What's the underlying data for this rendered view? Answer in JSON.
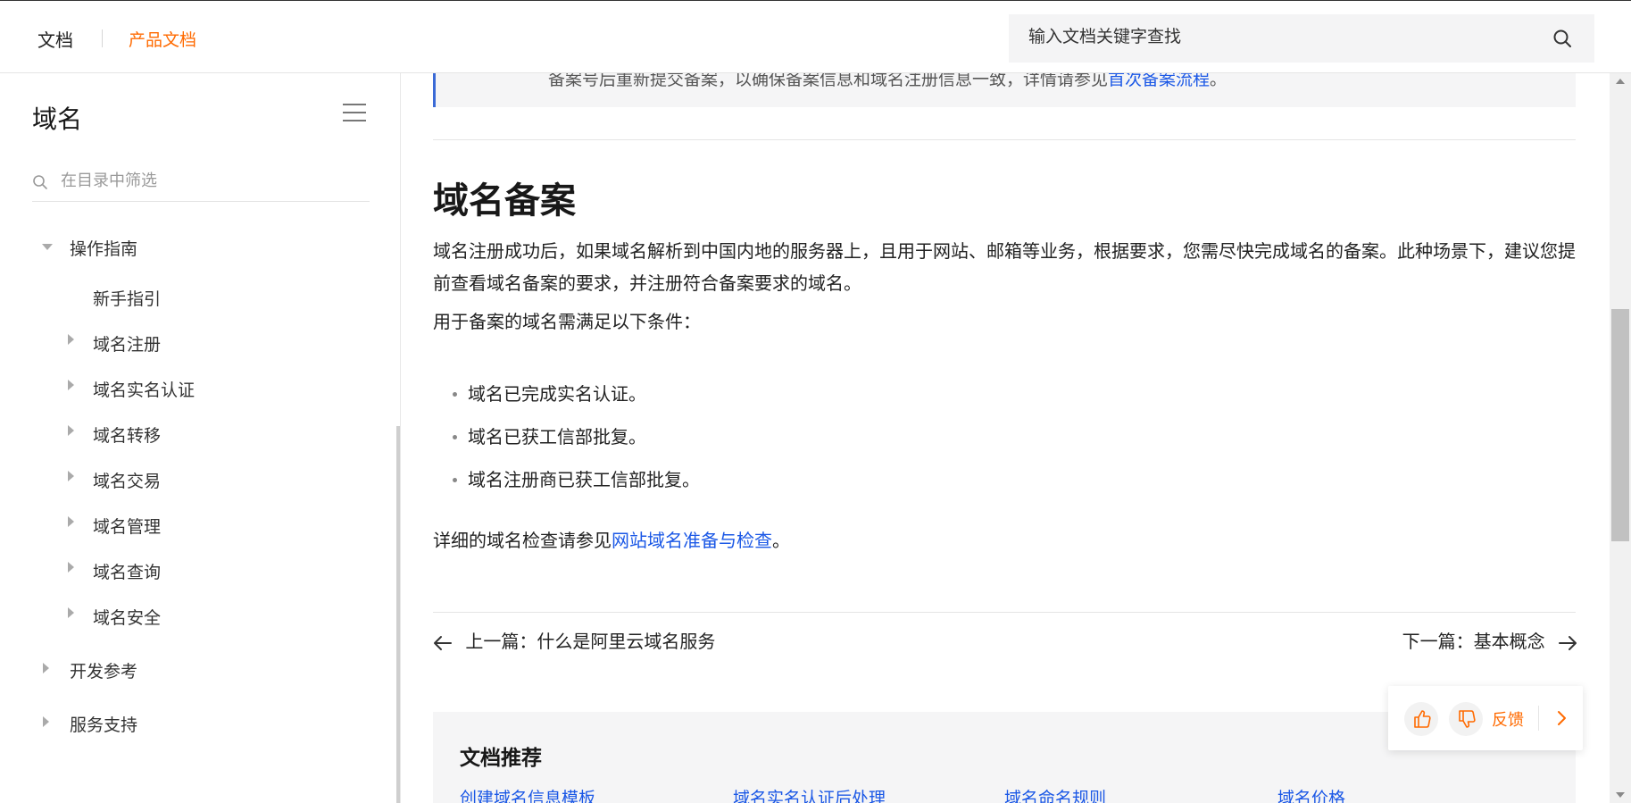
{
  "header": {
    "brand": "文档",
    "brand_sub": "产品文档",
    "search_placeholder": "输入文档关键字查找",
    "accent_color": "#ff6a00"
  },
  "sidebar": {
    "title": "域名",
    "filter_placeholder": "在目录中筛选",
    "items": [
      {
        "label": "操作指南",
        "state": "expanded"
      },
      {
        "label": "新手指引"
      },
      {
        "label": "域名注册",
        "state": "collapsed"
      },
      {
        "label": "域名实名认证",
        "state": "collapsed"
      },
      {
        "label": "域名转移",
        "state": "collapsed"
      },
      {
        "label": "域名交易",
        "state": "collapsed"
      },
      {
        "label": "域名管理",
        "state": "collapsed"
      },
      {
        "label": "域名查询",
        "state": "collapsed"
      },
      {
        "label": "域名安全",
        "state": "collapsed"
      },
      {
        "label": "开发参考",
        "state": "collapsed"
      },
      {
        "label": "服务支持",
        "state": "collapsed"
      }
    ]
  },
  "content": {
    "note_text": "备案号后重新提交备案，以确保备案信息和域名注册信息一致，详情请参见",
    "note_link": "首次备案流程",
    "note_tail": "。",
    "heading": "域名备案",
    "para1": "域名注册成功后，如果域名解析到中国内地的服务器上，且用于网站、邮箱等业务，根据要求，您需尽快完成域名的备案。此种场景下，建议您提前查看域名备案的要求，并注册符合备案要求的域名。",
    "para2": "用于备案的域名需满足以下条件：",
    "bullets": [
      "域名已完成实名认证。",
      "域名已获工信部批复。",
      "域名注册商已获工信部批复。"
    ],
    "para3_prefix": "详细的域名检查请参见",
    "para3_link": "网站域名准备与检查",
    "para3_suffix": "。",
    "prev": "上一篇：什么是阿里云域名服务",
    "next": "下一篇：基本概念",
    "recommend_title": "文档推荐",
    "recommend_links": [
      "创建域名信息模板",
      "域名实名认证后处理",
      "域名命名规则",
      "域名价格"
    ]
  },
  "feedback": {
    "label": "反馈"
  },
  "colors": {
    "link": "#1b58e6",
    "accent": "#ff6a00",
    "note_border": "#3b6ad6"
  }
}
